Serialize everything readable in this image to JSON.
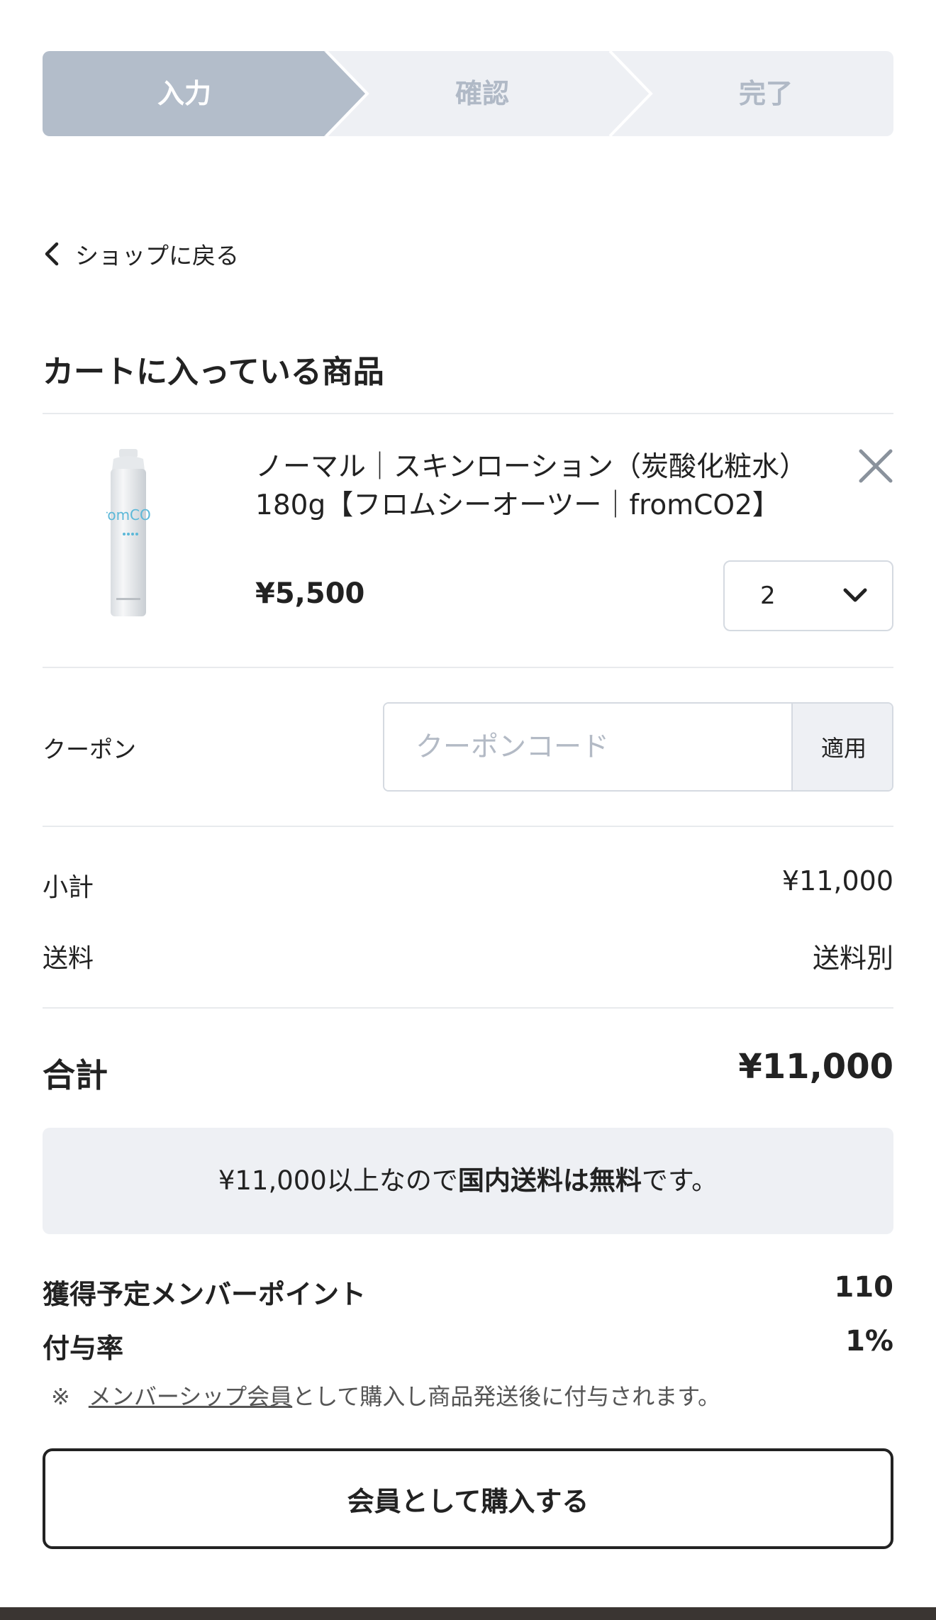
{
  "steps": [
    {
      "label": "入力",
      "active": true
    },
    {
      "label": "確認",
      "active": false
    },
    {
      "label": "完了",
      "active": false
    }
  ],
  "colors": {
    "step_active": "#b3bdca",
    "step_inactive": "#eef0f4",
    "text": "#222222"
  },
  "back_link": {
    "label": "ショップに戻る",
    "icon": "chevron-left-icon"
  },
  "cart": {
    "title": "カートに入っている商品",
    "items": [
      {
        "name": "ノーマル｜スキンローション（炭酸化粧水）180g【フロムシーオーツー｜fromCO2】",
        "price": "¥5,500",
        "quantity": "2",
        "image_text": "fromCO2"
      }
    ]
  },
  "coupon": {
    "label": "クーポン",
    "placeholder": "クーポンコード",
    "apply_label": "適用"
  },
  "summary": {
    "subtotal_label": "小計",
    "subtotal_value": "¥11,000",
    "shipping_label": "送料",
    "shipping_value": "送料別",
    "total_label": "合計",
    "total_value": "¥11,000"
  },
  "notice": {
    "prefix": "¥11,000以上なので",
    "bold": "国内送料は無料",
    "suffix": "です。"
  },
  "points": {
    "earn_label": "獲得予定メンバーポイント",
    "earn_value": "110",
    "rate_label": "付与率",
    "rate_value": "1%",
    "note_mark": "※",
    "note_link": "メンバーシップ会員",
    "note_text": "として購入し商品発送後に付与されます。"
  },
  "buy_button": {
    "label": "会員として購入する"
  }
}
